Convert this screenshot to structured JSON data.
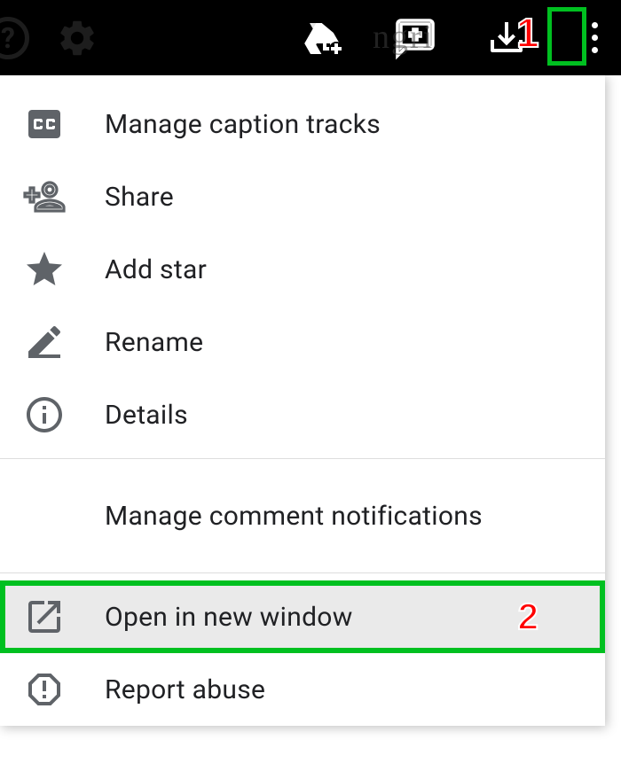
{
  "toolbar": {
    "help": "?",
    "gear": "Settings",
    "drive": "Add to Drive",
    "comment": "Add comment",
    "download": "Download",
    "more": "More actions"
  },
  "menu": {
    "items": [
      {
        "id": "captions",
        "label": "Manage caption tracks",
        "icon": "cc"
      },
      {
        "id": "share",
        "label": "Share",
        "icon": "person-add"
      },
      {
        "id": "star",
        "label": "Add star",
        "icon": "star"
      },
      {
        "id": "rename",
        "label": "Rename",
        "icon": "edit"
      },
      {
        "id": "details",
        "label": "Details",
        "icon": "info"
      }
    ],
    "section2": [
      {
        "id": "notifications",
        "label": "Manage comment notifications",
        "icon": ""
      }
    ],
    "section3": [
      {
        "id": "newwindow",
        "label": "Open in new window",
        "icon": "open-new"
      },
      {
        "id": "report",
        "label": "Report abuse",
        "icon": "report"
      }
    ]
  },
  "annotations": {
    "step1": "1",
    "step2": "2"
  },
  "background_text": "ngri"
}
